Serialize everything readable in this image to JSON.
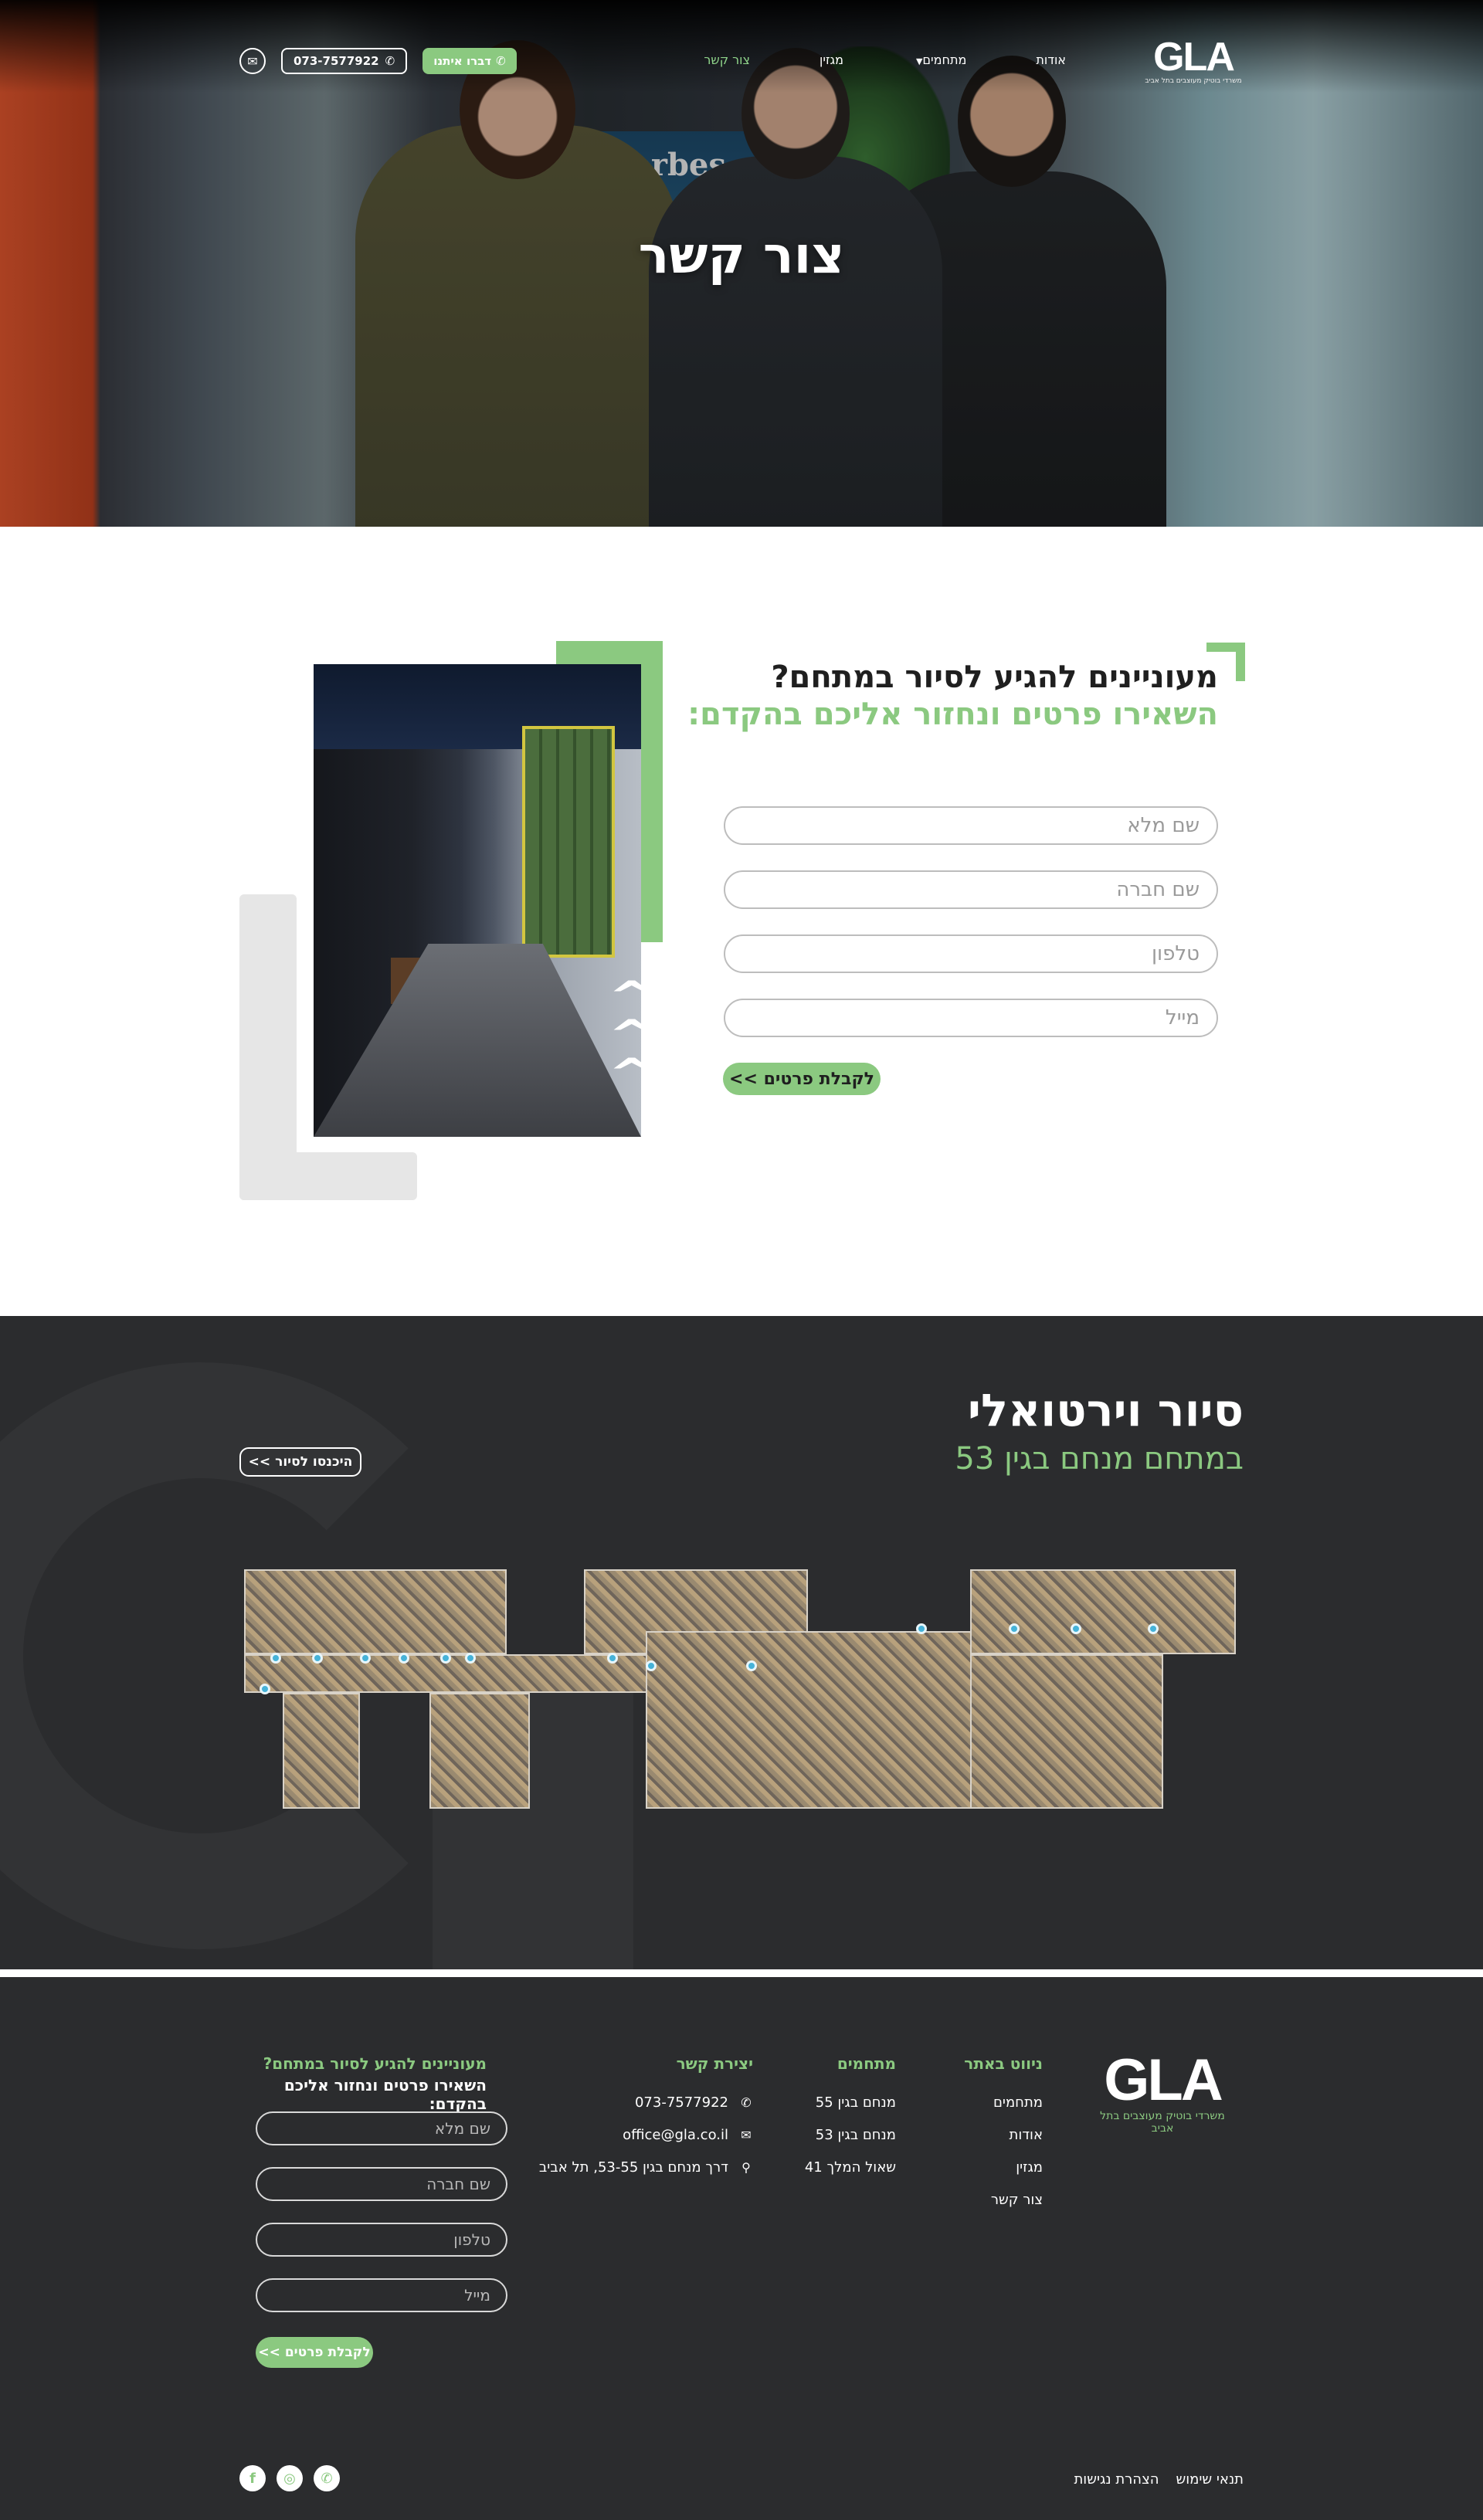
{
  "header": {
    "logo_text": "GLA",
    "logo_tagline": "משרדי בוטיק מעוצבים בתל אביב",
    "nav": [
      {
        "label": "אודות"
      },
      {
        "label": "מתחמים"
      },
      {
        "label": "מגזין"
      },
      {
        "label": "צור קשר"
      }
    ],
    "phone_label": "073-7577922",
    "whatsapp_label": "דברו איתנו"
  },
  "hero": {
    "title": "צור קשר",
    "poster_text": "Forbes"
  },
  "form_section": {
    "title": "מעוניינים להגיע לסיור במתחם?",
    "subtitle": "השאירו פרטים ונחזור אליכם בהקדם:",
    "fields": {
      "name": "שם מלא",
      "company": "שם חברה",
      "phone": "טלפון",
      "email": "מייל"
    },
    "submit_label": "לקבלת פרטים >>"
  },
  "virtual_tour": {
    "title": "סיור וירטואלי",
    "subtitle": "במתחם מנחם בגין 53",
    "button_label": "היכנסו לסיור >>"
  },
  "footer": {
    "logo_text": "GLA",
    "logo_tagline": "משרדי בוטיק מעוצבים בתל אביב",
    "nav_column": {
      "title": "ניווט באתר",
      "items": [
        "מתחמים",
        "אודות",
        "מגזין",
        "צור קשר"
      ]
    },
    "complexes_column": {
      "title": "מתחמים",
      "items": [
        "מנחם בגין 55",
        "מנחם בגין 53",
        "שאול המלך 41"
      ]
    },
    "contact_column": {
      "title": "יצירת קשר",
      "phone": "073-7577922",
      "email": "office@gla.co.il",
      "address": "דרך מנחם בגין 53-55, תל אביב"
    },
    "form": {
      "title": "מעוניינים להגיע לסיור במתחם?",
      "subtitle": "השאירו פרטים ונחזור אליכם בהקדם:",
      "fields": {
        "name": "שם מלא",
        "company": "שם חברה",
        "phone": "טלפון",
        "email": "מייל"
      },
      "submit_label": "לקבלת פרטים >>"
    },
    "legal": {
      "terms": "תנאי שימוש",
      "accessibility": "הצהרת נגישות"
    },
    "social_icons": [
      "whatsapp-icon",
      "instagram-icon",
      "facebook-icon"
    ]
  },
  "colors": {
    "accent_green": "#8bc980",
    "dark_bg": "#2b2c2e"
  }
}
